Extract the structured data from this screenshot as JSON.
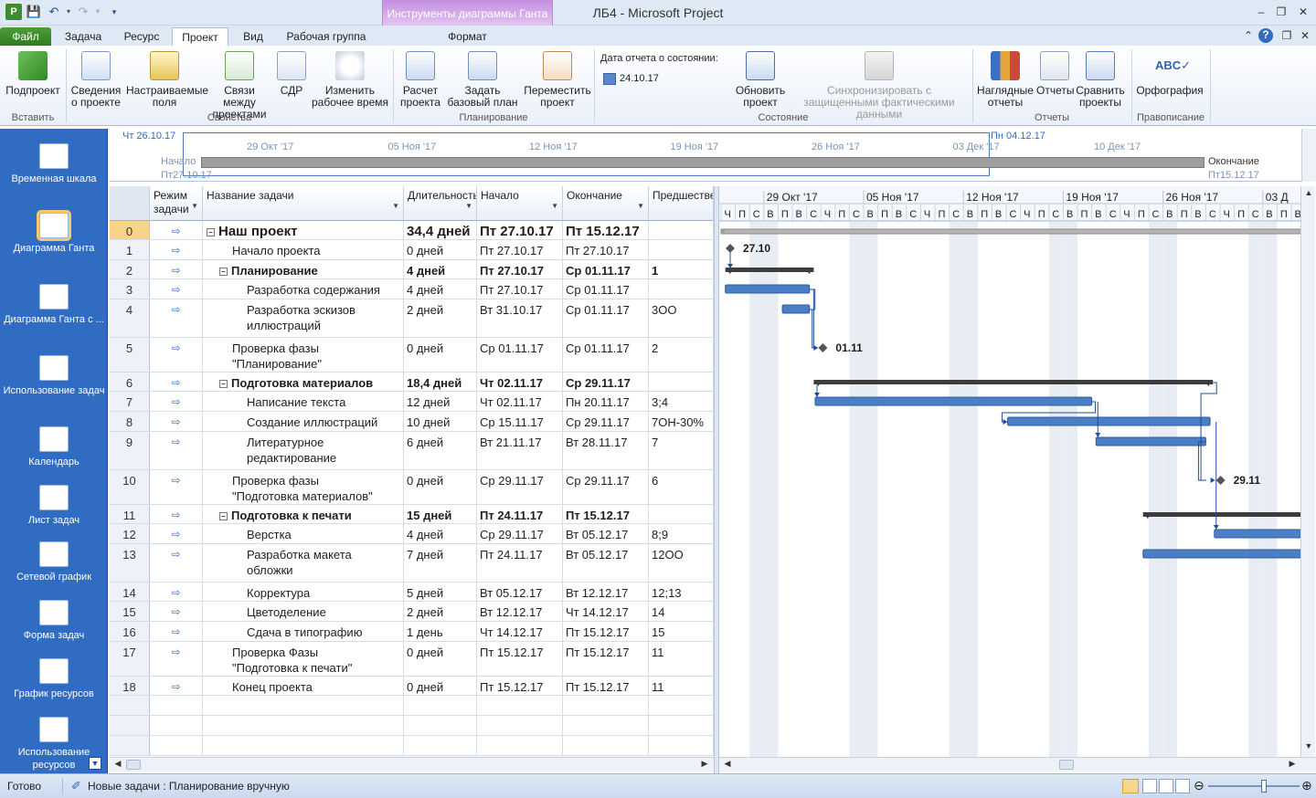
{
  "window": {
    "title": "ЛБ4  -  Microsoft Project",
    "contextual_tab_group": "Инструменты диаграммы Ганта"
  },
  "tabs": [
    {
      "label": "Файл"
    },
    {
      "label": "Задача"
    },
    {
      "label": "Ресурс"
    },
    {
      "label": "Проект"
    },
    {
      "label": "Вид"
    },
    {
      "label": "Рабочая группа"
    },
    {
      "label": "Формат"
    }
  ],
  "active_tab": "Проект",
  "ribbon": {
    "insert": {
      "subproject": "Подпроект",
      "group": "Вставить"
    },
    "properties": {
      "project_info": "Сведения о проекте",
      "custom_fields": "Настраиваемые поля",
      "links": "Связи между проектами",
      "wbs": "СДР",
      "work_time": "Изменить рабочее время",
      "group": "Свойства"
    },
    "schedule": {
      "calculate": "Расчет проекта",
      "baseline": "Задать базовый план",
      "move": "Переместить проект",
      "group": "Планирование"
    },
    "status": {
      "status_date_label": "Дата отчета о состоянии:",
      "status_date": "24.10.17",
      "update": "Обновить проект",
      "sync": "Синхронизировать с защищенными фактическими данными",
      "group": "Состояние"
    },
    "reports": {
      "visual": "Наглядные отчеты",
      "reports": "Отчеты",
      "compare": "Сравнить проекты",
      "group": "Отчеты"
    },
    "proofing": {
      "spelling": "Орфография",
      "group": "Правописание"
    }
  },
  "viewbar": [
    {
      "label": "Временная шкала",
      "icon": "timeline-icon"
    },
    {
      "label": "Диаграмма Ганта",
      "icon": "gantt-icon",
      "active": true
    },
    {
      "label": "Диаграмма Ганта с ...",
      "icon": "tracking-gantt-icon"
    },
    {
      "label": "Использование задач",
      "icon": "task-usage-icon"
    },
    {
      "label": "Календарь",
      "icon": "calendar-icon"
    },
    {
      "label": "Лист задач",
      "icon": "task-sheet-icon"
    },
    {
      "label": "Сетевой график",
      "icon": "network-icon"
    },
    {
      "label": "Форма задач",
      "icon": "task-form-icon"
    },
    {
      "label": "График ресурсов",
      "icon": "resource-graph-icon"
    },
    {
      "label": "Использование ресурсов",
      "icon": "resource-usage-icon"
    }
  ],
  "timeline": {
    "today_left": "Чт 26.10.17",
    "today_right": "Пн 04.12.17",
    "start_label": "Начало",
    "start_date": "Пт27.10.17",
    "finish_label": "Окончание",
    "finish_date": "Пт15.12.17",
    "ticks": [
      "29 Окт '17",
      "05 Ноя '17",
      "12 Ноя '17",
      "19 Ноя '17",
      "26 Ноя '17",
      "03 Дек '17",
      "10 Дек '17"
    ]
  },
  "grid": {
    "headers": {
      "mode": "Режим задачи",
      "name": "Название задачи",
      "duration": "Длительность",
      "start": "Начало",
      "finish": "Окончание",
      "pred": "Предшественники"
    },
    "rows": [
      {
        "id": "0",
        "name": "Наш проект",
        "duration": "34,4 дней",
        "start": "Пт 27.10.17",
        "finish": "Пт 15.12.17",
        "pred": "",
        "level": 0,
        "summary": true,
        "big": true
      },
      {
        "id": "1",
        "name": "Начало проекта",
        "duration": "0 дней",
        "start": "Пт 27.10.17",
        "finish": "Пт 27.10.17",
        "pred": "",
        "level": 1
      },
      {
        "id": "2",
        "name": "Планирование",
        "duration": "4 дней",
        "start": "Пт 27.10.17",
        "finish": "Ср 01.11.17",
        "pred": "1",
        "level": 1,
        "summary": true
      },
      {
        "id": "3",
        "name": "Разработка содержания",
        "duration": "4 дней",
        "start": "Пт 27.10.17",
        "finish": "Ср 01.11.17",
        "pred": "",
        "level": 2
      },
      {
        "id": "4",
        "name": "Разработка эскизов",
        "name2": "иллюстраций",
        "duration": "2 дней",
        "start": "Вт 31.10.17",
        "finish": "Ср 01.11.17",
        "pred": "3ОО",
        "level": 2
      },
      {
        "id": "5",
        "name": "Проверка фазы",
        "name2": "\"Планирование\"",
        "duration": "0 дней",
        "start": "Ср 01.11.17",
        "finish": "Ср 01.11.17",
        "pred": "2",
        "level": 1
      },
      {
        "id": "6",
        "name": "Подготовка материалов",
        "duration": "18,4 дней",
        "start": "Чт 02.11.17",
        "finish": "Ср 29.11.17",
        "pred": "",
        "level": 1,
        "summary": true
      },
      {
        "id": "7",
        "name": "Написание текста",
        "duration": "12 дней",
        "start": "Чт 02.11.17",
        "finish": "Пн 20.11.17",
        "pred": "3;4",
        "level": 2
      },
      {
        "id": "8",
        "name": "Создание иллюстраций",
        "duration": "10 дней",
        "start": "Ср 15.11.17",
        "finish": "Ср 29.11.17",
        "pred": "7ОН-30%",
        "level": 2
      },
      {
        "id": "9",
        "name": "Литературное",
        "name2": "редактирование",
        "duration": "6 дней",
        "start": "Вт 21.11.17",
        "finish": "Вт 28.11.17",
        "pred": "7",
        "level": 2
      },
      {
        "id": "10",
        "name": "Проверка фазы",
        "name2": "\"Подготовка материалов\"",
        "duration": "0 дней",
        "start": "Ср 29.11.17",
        "finish": "Ср 29.11.17",
        "pred": "6",
        "level": 1
      },
      {
        "id": "11",
        "name": "Подготовка к печати",
        "duration": "15 дней",
        "start": "Пт 24.11.17",
        "finish": "Пт 15.12.17",
        "pred": "",
        "level": 1,
        "summary": true
      },
      {
        "id": "12",
        "name": "Верстка",
        "duration": "4 дней",
        "start": "Ср 29.11.17",
        "finish": "Вт 05.12.17",
        "pred": "8;9",
        "level": 2
      },
      {
        "id": "13",
        "name": "Разработка макета",
        "name2": "обложки",
        "duration": "7 дней",
        "start": "Пт 24.11.17",
        "finish": "Вт 05.12.17",
        "pred": "12ОО",
        "level": 2
      },
      {
        "id": "14",
        "name": "Корректура",
        "duration": "5 дней",
        "start": "Вт 05.12.17",
        "finish": "Вт 12.12.17",
        "pred": "12;13",
        "level": 2
      },
      {
        "id": "15",
        "name": "Цветоделение",
        "duration": "2 дней",
        "start": "Вт 12.12.17",
        "finish": "Чт 14.12.17",
        "pred": "14",
        "level": 2
      },
      {
        "id": "16",
        "name": "Сдача в типографию",
        "duration": "1 день",
        "start": "Чт 14.12.17",
        "finish": "Пт 15.12.17",
        "pred": "15",
        "level": 2
      },
      {
        "id": "17",
        "name": "Проверка Фазы",
        "name2": "\"Подготовка к печати\"",
        "duration": "0 дней",
        "start": "Пт 15.12.17",
        "finish": "Пт 15.12.17",
        "pred": "11",
        "level": 1
      },
      {
        "id": "18",
        "name": "Конец проекта",
        "duration": "0 дней",
        "start": "Пт 15.12.17",
        "finish": "Пт 15.12.17",
        "pred": "11",
        "level": 1
      }
    ]
  },
  "gantt": {
    "week_labels": [
      "29 Окт '17",
      "05 Ноя '17",
      "12 Ноя '17",
      "19 Ноя '17",
      "26 Ноя '17",
      "03 Д"
    ],
    "day_letters": [
      "Ч",
      "П",
      "С",
      "В",
      "П",
      "В",
      "С",
      "Ч",
      "П",
      "С",
      "В",
      "П",
      "В",
      "С",
      "Ч",
      "П",
      "С",
      "В",
      "П",
      "В",
      "С",
      "Ч",
      "П",
      "С",
      "В",
      "П",
      "В",
      "С",
      "Ч",
      "П",
      "С",
      "В",
      "П",
      "В",
      "С",
      "Ч",
      "П",
      "С",
      "В",
      "П",
      "В",
      "С",
      "Ч",
      "П",
      "С",
      "В",
      "П",
      "В",
      "С",
      "Ч",
      "П",
      "С",
      "В",
      "П",
      "В"
    ],
    "milestone_labels": {
      "start": "27.10",
      "plan": "01.11",
      "materials": "29.11"
    },
    "colors": {
      "task_bar": "#4a7fc6",
      "summary_bar": "#3d3d3d",
      "weekend": "#e8edf4",
      "link": "#1f4e9a"
    }
  },
  "statusbar": {
    "ready": "Готово",
    "new_tasks": "Новые задачи : Планирование вручную"
  }
}
